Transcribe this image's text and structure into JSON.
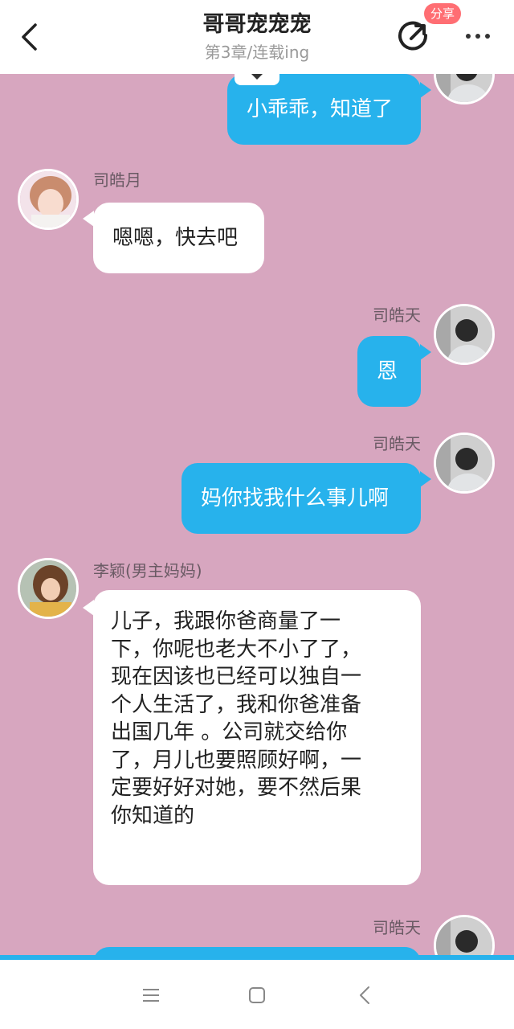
{
  "header": {
    "title": "哥哥宠宠宠",
    "subtitle": "第3章/连载ing",
    "share_badge": "分享"
  },
  "messages": [
    {
      "side": "right",
      "sender": "",
      "text": "小乖乖，知道了"
    },
    {
      "side": "left",
      "sender": "司皓月",
      "text": "嗯嗯，快去吧"
    },
    {
      "side": "right",
      "sender": "司皓天",
      "text": "恩"
    },
    {
      "side": "right",
      "sender": "司皓天",
      "text": "妈你找我什么事儿啊"
    },
    {
      "side": "left",
      "sender": "李颖(男主妈妈)",
      "lines": [
        "儿子，我跟你爸商量了一",
        "下，你呢也老大不小了了，",
        "现在因该也已经可以独自一",
        "个人生活了，我和你爸准备",
        "出国几年 。公司就交给你",
        "了，月儿也要照顾好啊，一",
        "定要好好对她，要不然后果",
        "你知道的"
      ]
    },
    {
      "side": "right",
      "sender": "司皓天",
      "text": ""
    }
  ],
  "colors": {
    "chat_background": "#d7a6bf",
    "blue_bubble": "#27b2ec",
    "white_bubble": "#ffffff",
    "badge": "#ff6e73"
  },
  "icons": {
    "back": "chevron-left-icon",
    "share": "share-icon",
    "more": "more-dots-icon",
    "menu": "menu-lines-icon",
    "home": "square-home-icon",
    "nav_back": "triangle-back-icon"
  }
}
